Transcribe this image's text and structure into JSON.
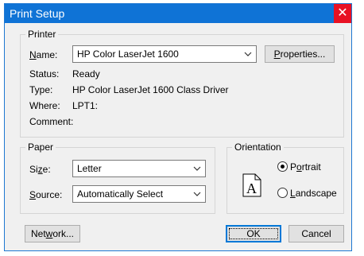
{
  "window": {
    "title": "Print Setup",
    "close_glyph": "✕"
  },
  "printer": {
    "group_label": "Printer",
    "name_label": "Name:",
    "name_value": "HP Color LaserJet 1600",
    "properties_label": "Properties...",
    "status_label": "Status:",
    "status_value": "Ready",
    "type_label": "Type:",
    "type_value": "HP Color LaserJet 1600 Class Driver",
    "where_label": "Where:",
    "where_value": "LPT1:",
    "comment_label": "Comment:",
    "comment_value": ""
  },
  "paper": {
    "group_label": "Paper",
    "size_label": "Size:",
    "size_value": "Letter",
    "source_label": "Source:",
    "source_value": "Automatically Select"
  },
  "orientation": {
    "group_label": "Orientation",
    "portrait_label": "Portrait",
    "landscape_label": "Landscape",
    "selected": "Portrait",
    "preview_letter": "A"
  },
  "buttons": {
    "network": "Network...",
    "ok": "OK",
    "cancel": "Cancel"
  },
  "colors": {
    "titlebar": "#0f73d6",
    "close": "#e81123",
    "focus_border": "#0078d7"
  }
}
